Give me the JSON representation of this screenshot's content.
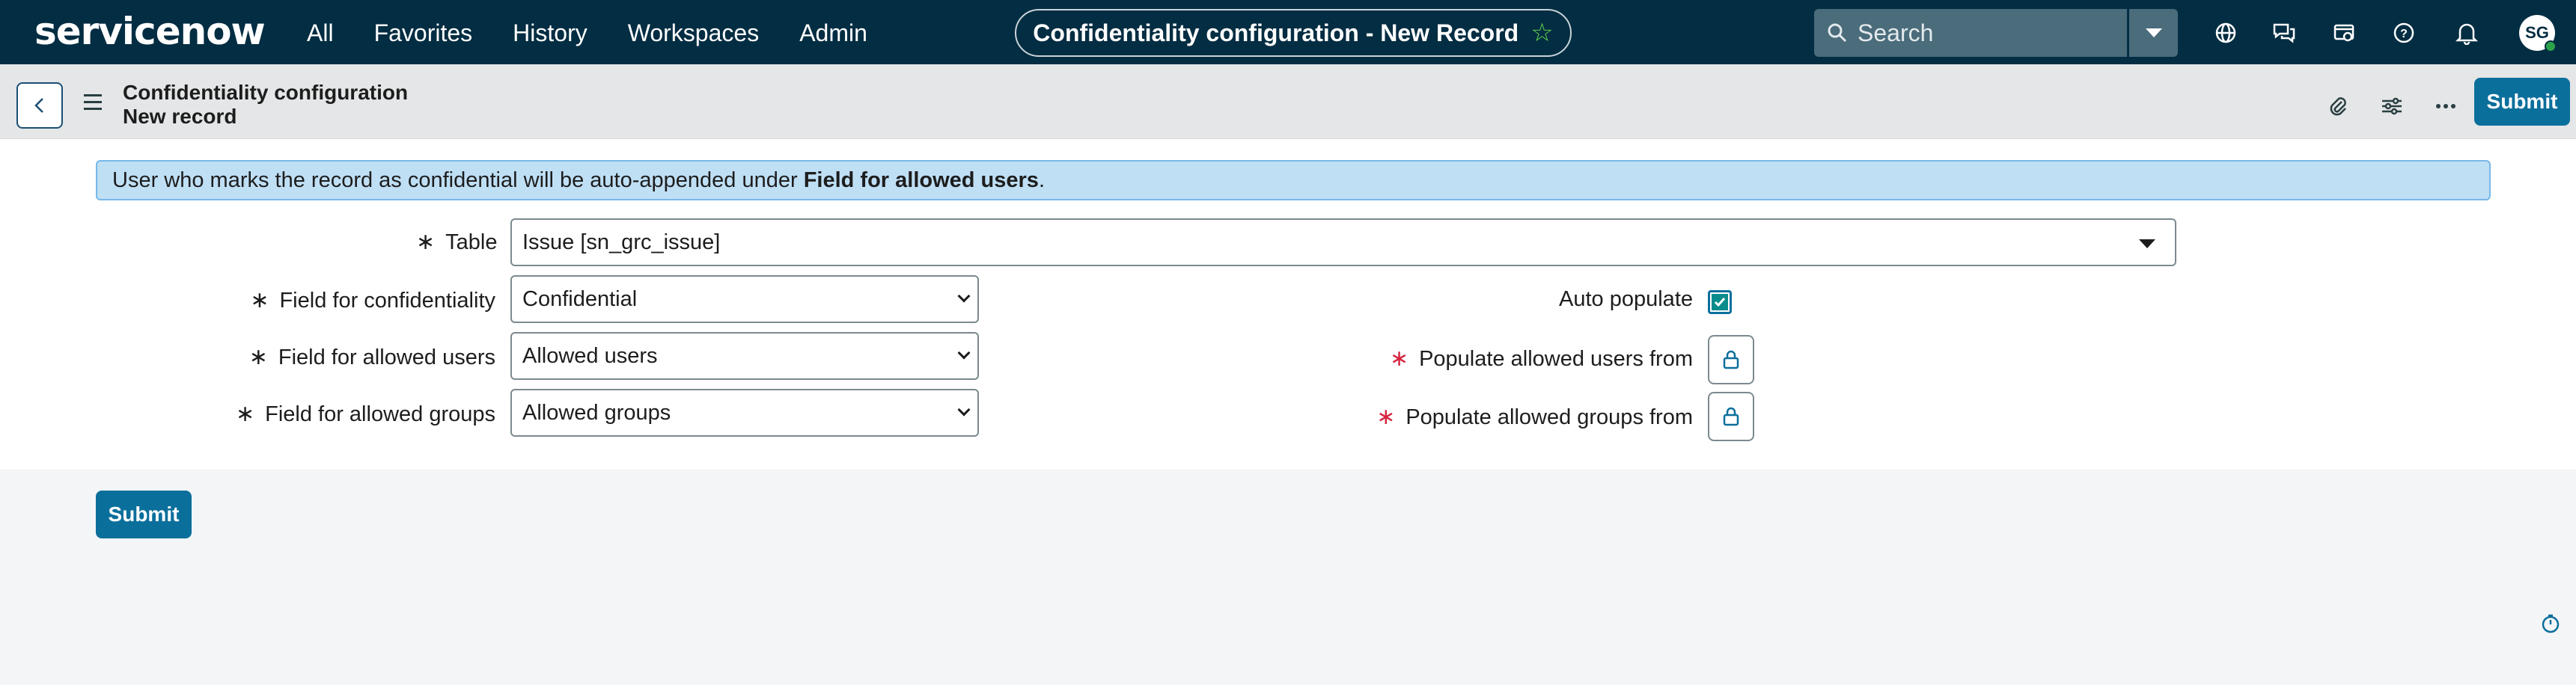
{
  "nav": {
    "logo": "servicenow",
    "menu": [
      "All",
      "Favorites",
      "History",
      "Workspaces",
      "Admin"
    ],
    "record_title": "Confidentiality configuration - New Record",
    "search_placeholder": "Search",
    "avatar_initials": "SG",
    "icons": [
      "globe-icon",
      "chat-icon",
      "scripts-icon",
      "help-icon",
      "bell-icon"
    ]
  },
  "subheader": {
    "title_line1": "Confidentiality configuration",
    "title_line2": "New record",
    "submit_label": "Submit",
    "icons": [
      "paperclip-icon",
      "sliders-icon",
      "more-icon"
    ]
  },
  "form": {
    "banner_text": "User who marks the record as confidential will be auto-appended under ",
    "banner_bold": "Field for allowed users",
    "banner_end": ".",
    "table_label": "Table",
    "table_value": "Issue [sn_grc_issue]",
    "conf_label": "Field for confidentiality",
    "conf_value": "Confidential",
    "users_label": "Field for allowed users",
    "users_value": "Allowed users",
    "groups_label": "Field for allowed groups",
    "groups_value": "Allowed groups",
    "auto_label": "Auto populate",
    "auto_checked": true,
    "pop_users_label": "Populate allowed users from",
    "pop_groups_label": "Populate allowed groups from",
    "required_mark": "∗"
  },
  "footer": {
    "submit_label": "Submit"
  },
  "colors": {
    "nav_bg": "#032d42",
    "primary_button": "#0b6f9c",
    "banner_bg": "#bfdff5",
    "required_red": "#d6243f",
    "star_green": "#62d84e"
  }
}
